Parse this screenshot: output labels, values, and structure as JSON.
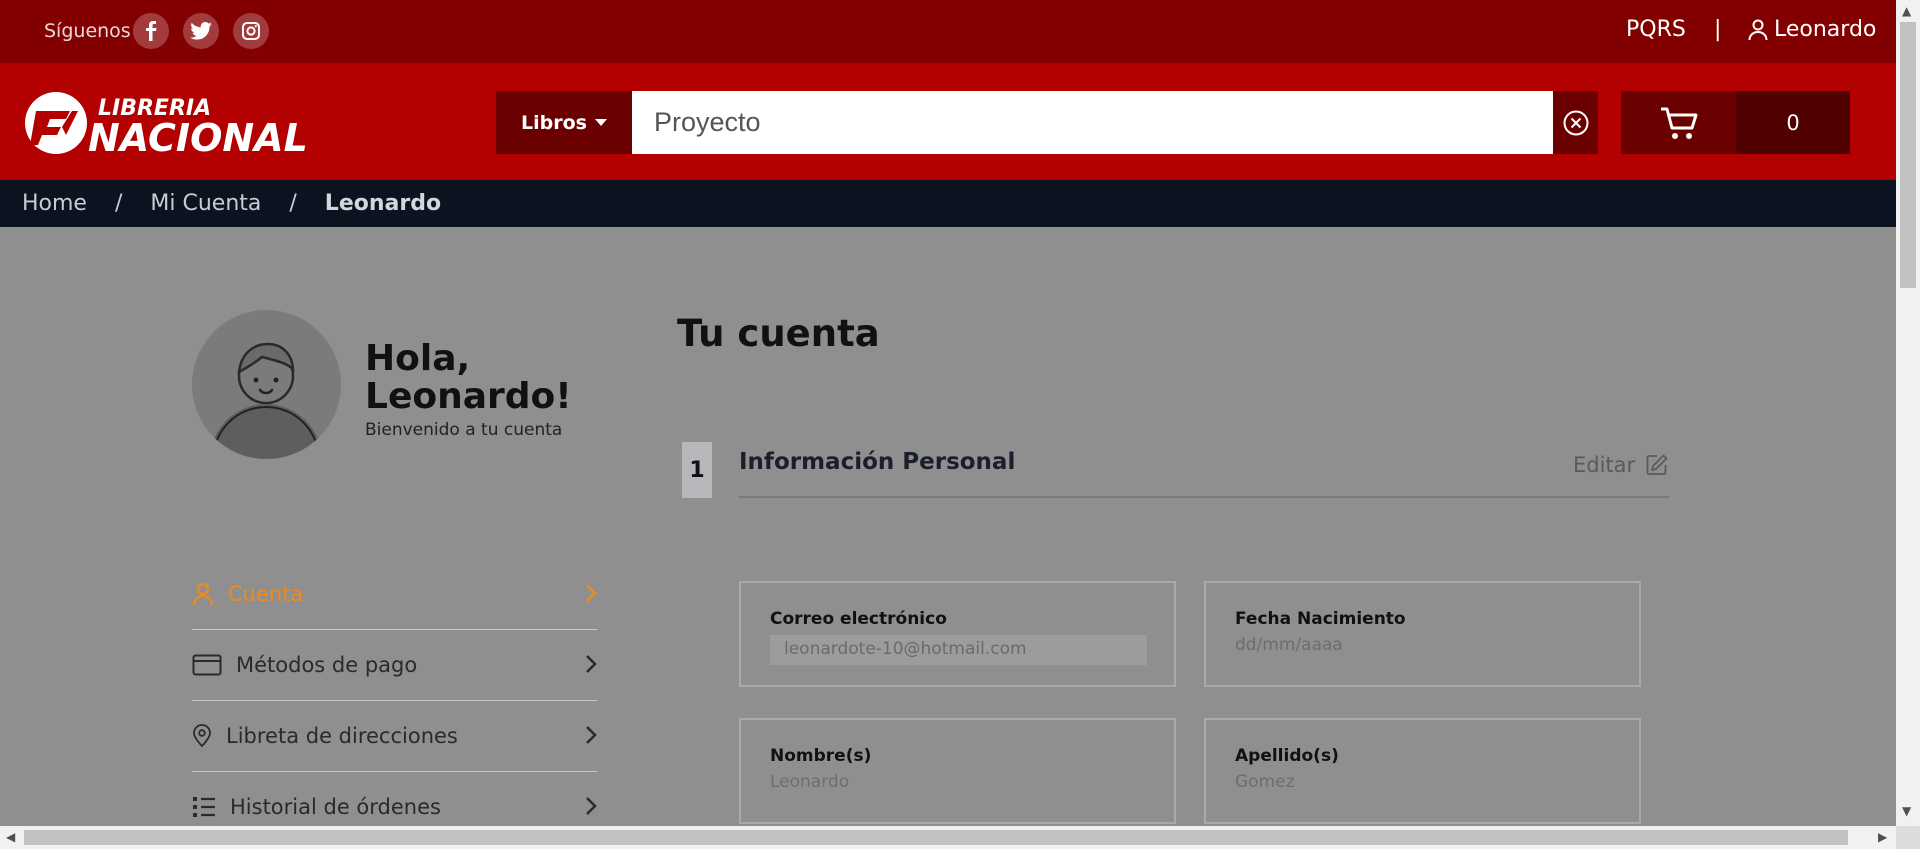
{
  "topbar": {
    "follow_label": "Síguenos",
    "pqrs_label": "PQRS",
    "separator": "|",
    "user_name": "Leonardo"
  },
  "header": {
    "logo_text_top": "LIBRERIA",
    "logo_text_bottom": "NACIONAL",
    "category_label": "Libros",
    "search_value": "Proyecto",
    "cart_count": "0"
  },
  "breadcrumb": {
    "items": [
      "Home",
      "/",
      "Mi Cuenta",
      "/",
      "Leonardo"
    ]
  },
  "profile": {
    "greeting": "Hola, Leonardo!",
    "welcome": "Bienvenido a tu cuenta"
  },
  "menu": {
    "items": [
      {
        "label": "Cuenta",
        "icon": "user-icon"
      },
      {
        "label": "Métodos de pago",
        "icon": "card-icon"
      },
      {
        "label": "Libreta de direcciones",
        "icon": "location-pin-icon"
      },
      {
        "label": "Historial de órdenes",
        "icon": "list-icon"
      }
    ]
  },
  "main": {
    "title": "Tu cuenta",
    "step_number": "1",
    "section_title": "Información Personal",
    "edit_label": "Editar",
    "fields": {
      "email": {
        "label": "Correo electrónico",
        "value": "leonardote-10@hotmail.com"
      },
      "birthdate": {
        "label": "Fecha Nacimiento",
        "placeholder": "dd/mm/aaaa"
      },
      "first_name": {
        "label": "Nombre(s)",
        "value": "Leonardo"
      },
      "last_name": {
        "label": "Apellido(s)",
        "value": "Gomez"
      }
    }
  },
  "colors": {
    "topbar": "#820000",
    "header": "#b30000",
    "dark_button": "#6a0000",
    "breadcrumb_bg": "#0b1220",
    "accent_orange": "#f08a1c"
  }
}
